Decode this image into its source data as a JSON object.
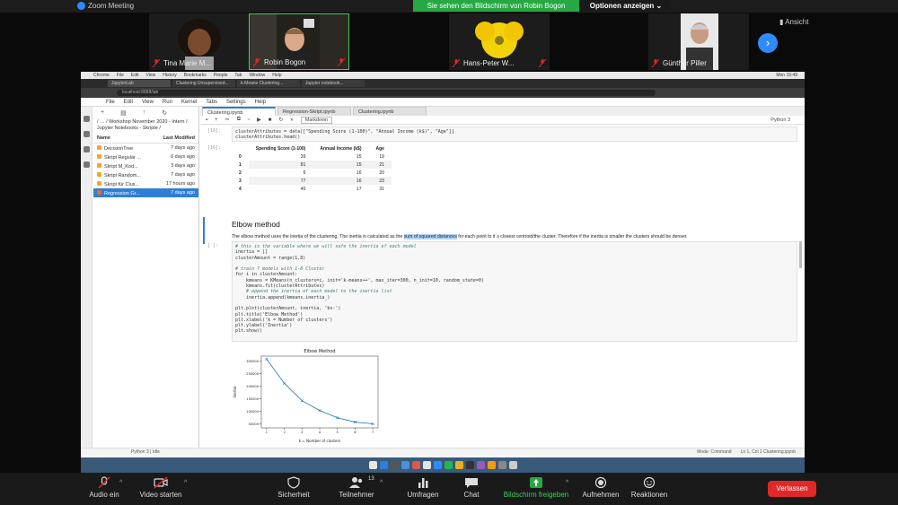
{
  "zoom": {
    "window_title": "Zoom Meeting",
    "share_banner": "Sie sehen den Bildschirm von Robin Bogon",
    "options_label": "Optionen anzeigen ⌄",
    "view_label": "Ansicht",
    "participants": [
      {
        "name": "Tina Marie M..."
      },
      {
        "name": "Robin Bogon"
      },
      {
        "name": "Hans-Peter W..."
      },
      {
        "name": "Günther Piller"
      }
    ],
    "toolbar": {
      "audio": "Audio ein",
      "video": "Video starten",
      "security": "Sicherheit",
      "participants": "Teilnehmer",
      "participants_count": "13",
      "polls": "Umfragen",
      "chat": "Chat",
      "share": "Bildschirm freigeben",
      "record": "Aufnehmen",
      "reactions": "Reaktionen",
      "leave": "Verlassen"
    }
  },
  "browser": {
    "mac_menu": [
      "Chrome",
      "File",
      "Edit",
      "View",
      "History",
      "Bookmarks",
      "People",
      "Tab",
      "Window",
      "Help"
    ],
    "clock": "Mon 15:49",
    "tabs": [
      "JupyterLab",
      "Clustering Unsupervised...",
      "k-Means Clustering...",
      "Jupyter notebook..."
    ],
    "url": "localhost:8888/lab"
  },
  "jupyter": {
    "menu": [
      "File",
      "Edit",
      "View",
      "Run",
      "Kernel",
      "Tabs",
      "Settings",
      "Help"
    ],
    "filebrowser": {
      "path": "/ … / Workshop November 2020 - Intern / Jupyter Notebooks - Skripte /",
      "col_name": "Name",
      "col_modified": "Last Modified",
      "files": [
        {
          "name": "DecisionTree",
          "modified": "7 days ago",
          "kind": "folder",
          "selected": false
        },
        {
          "name": "Skript Regulär ...",
          "modified": "6 days ago",
          "kind": "folder",
          "selected": false
        },
        {
          "name": "Skript M_Kod...",
          "modified": "3 days ago",
          "kind": "folder",
          "selected": false
        },
        {
          "name": "Skript Random...",
          "modified": "7 days ago",
          "kind": "folder",
          "selected": false
        },
        {
          "name": "Skript für Clus...",
          "modified": "17 hours ago",
          "kind": "folder",
          "selected": false
        },
        {
          "name": "Regression Gr...",
          "modified": "7 days ago",
          "kind": "notebook",
          "selected": true
        }
      ]
    },
    "notebook_tabs": [
      "Clustering.ipynb",
      "Regression-Skript.ipynb",
      "Clustering.ipynb"
    ],
    "cell_type": "Markdown",
    "kernel": "Python 3",
    "cell1_prompt": "[16]:",
    "cell1_code": "clusterAttributes = data[[\"Spending Score (1-100)\", \"Annual Income (k$)\", \"Age\"]]\nclusterAttributes.head()",
    "out1_prompt": "[16]:",
    "df_columns": [
      "Spending Score (1-100)",
      "Annual Income (k$)",
      "Age"
    ],
    "df_rows": [
      [
        "0",
        "39",
        "15",
        "19"
      ],
      [
        "1",
        "81",
        "15",
        "21"
      ],
      [
        "2",
        "6",
        "16",
        "20"
      ],
      [
        "3",
        "77",
        "16",
        "23"
      ],
      [
        "4",
        "40",
        "17",
        "31"
      ]
    ],
    "md_heading": "Elbow method",
    "md_text_pre": "The elbow method uses the inertia of the clustering. The inertia is calculated as the ",
    "md_text_highlight": "sum of squared distances",
    "md_text_post": " for each point to it´s closest centroid/the cluster. Therefore if the inertia is smaller the clusters should be denser.",
    "cell2_prompt": "[ ]:",
    "cell2_code": [
      {
        "t": "# this is the variable where we will safe the inertia of each model",
        "c": true
      },
      {
        "t": "inertia = []",
        "c": false
      },
      {
        "t": "clusterAmount = range(1,8)",
        "c": false
      },
      {
        "t": "",
        "c": false
      },
      {
        "t": "# train 7 models with 1-8 Cluster",
        "c": true
      },
      {
        "t": "for i in clusterAmount:",
        "c": false
      },
      {
        "t": "    kmeans = KMeans(n_clusters=i, init='k-means++', max_iter=300, n_init=10, random_state=0)",
        "c": false
      },
      {
        "t": "    kmeans.fit(clusterAttributes)",
        "c": false
      },
      {
        "t": "    # append the inertia of each model to the inertia list",
        "c": true
      },
      {
        "t": "    inertia.append(kmeans.inertia_)",
        "c": false
      },
      {
        "t": "",
        "c": false
      },
      {
        "t": "plt.plot(clusterAmount, inertia, 'bx-')",
        "c": false
      },
      {
        "t": "plt.title('Elbow Method')",
        "c": false
      },
      {
        "t": "plt.xlabel('k = Number of clusters')",
        "c": false
      },
      {
        "t": "plt.ylabel('Inertia')",
        "c": false
      },
      {
        "t": "plt.show()",
        "c": false
      }
    ],
    "status_left": "Python 3 | Idle",
    "status_mode": "Mode: Command",
    "status_right": "Ln 1, Col 1    Clustering.ipynb"
  },
  "chart_data": {
    "type": "line",
    "title": "Elbow Method",
    "xlabel": "k = Number of clusters",
    "ylabel": "Inertia",
    "x": [
      1,
      2,
      3,
      4,
      5,
      6,
      7
    ],
    "values": [
      308000,
      212000,
      143000,
      104000,
      75000,
      58000,
      51000
    ],
    "xlim": [
      0.7,
      7.3
    ],
    "ylim": [
      35000,
      320000
    ],
    "yticks": [
      50000,
      100000,
      150000,
      200000,
      250000,
      300000
    ],
    "ytick_labels": [
      "50000",
      "100000",
      "150000",
      "200000",
      "250000",
      "300000"
    ],
    "xticks": [
      1,
      2,
      3,
      4,
      5,
      6,
      7
    ],
    "color": "#1f77b4"
  },
  "colors": {
    "zoom_blue": "#2d8cff",
    "share_green": "#26a843",
    "leave_red": "#e02828",
    "jupyter_blue": "#2f7ed8"
  }
}
